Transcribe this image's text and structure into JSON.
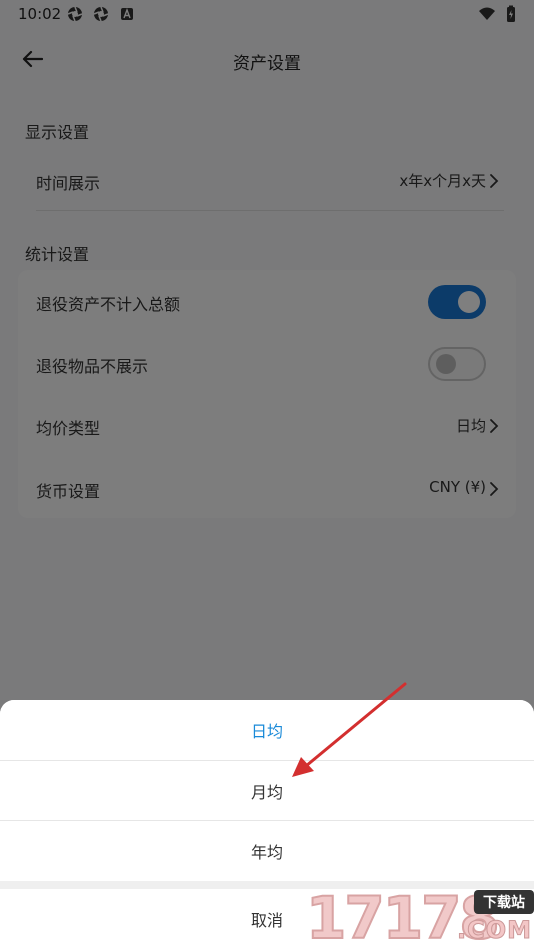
{
  "status_bar": {
    "time": "10:02"
  },
  "header": {
    "title": "资产设置"
  },
  "display_section": {
    "title": "显示设置",
    "time_display": {
      "label": "时间展示",
      "value": "x年x个月x天"
    }
  },
  "stats_section": {
    "title": "统计设置",
    "retired_asset_exclude": {
      "label": "退役资产不计入总额",
      "enabled": true
    },
    "retired_item_hide": {
      "label": "退役物品不展示",
      "enabled": false
    },
    "avg_type": {
      "label": "均价类型",
      "value": "日均"
    },
    "currency": {
      "label": "货币设置",
      "value": "CNY (¥)"
    }
  },
  "bottom_sheet": {
    "options": [
      {
        "label": "日均",
        "selected": true
      },
      {
        "label": "月均",
        "selected": false
      },
      {
        "label": "年均",
        "selected": false
      }
    ],
    "cancel_label": "取消"
  },
  "watermark": {
    "number": "17178",
    "badge": "下载站",
    "domain": ".COM"
  },
  "colors": {
    "accent": "#1976d2",
    "selected_option": "#1a8ad8",
    "arrow": "#d32f2f"
  }
}
